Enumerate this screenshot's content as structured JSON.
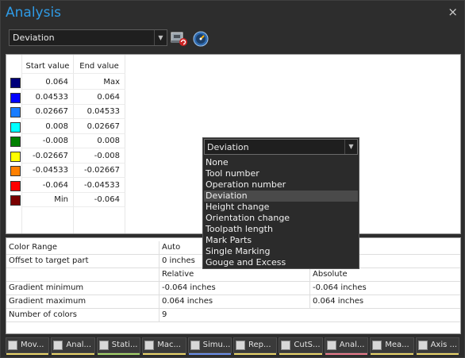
{
  "window": {
    "title": "Analysis",
    "close_glyph": "×"
  },
  "toolbar": {
    "mode_value": "Deviation",
    "icons": [
      "machine-icon",
      "gauge-icon"
    ]
  },
  "legend": {
    "headers": [
      "Start value",
      "End value"
    ],
    "rows": [
      {
        "color": "#00007a",
        "start": "0.064",
        "end": "Max"
      },
      {
        "color": "#0000ff",
        "start": "0.04533",
        "end": "0.064"
      },
      {
        "color": "#1a7dff",
        "start": "0.02667",
        "end": "0.04533"
      },
      {
        "color": "#00ffff",
        "start": "0.008",
        "end": "0.02667"
      },
      {
        "color": "#008000",
        "start": "-0.008",
        "end": "0.008"
      },
      {
        "color": "#ffff00",
        "start": "-0.02667",
        "end": "-0.008"
      },
      {
        "color": "#ff8000",
        "start": "-0.04533",
        "end": "-0.02667"
      },
      {
        "color": "#ff0000",
        "start": "-0.064",
        "end": "-0.04533"
      },
      {
        "color": "#7a0000",
        "start": "Min",
        "end": "-0.064"
      }
    ]
  },
  "properties": {
    "color_range_label": "Color Range",
    "color_range_value": "Auto",
    "offset_label": "Offset to target part",
    "offset_value": "0 inches",
    "relative_header": "Relative",
    "absolute_header": "Absolute",
    "grad_min_label": "Gradient minimum",
    "grad_min_rel": "-0.064 inches",
    "grad_min_abs": "-0.064 inches",
    "grad_max_label": "Gradient maximum",
    "grad_max_rel": "0.064 inches",
    "grad_max_abs": "0.064 inches",
    "num_colors_label": "Number of colors",
    "num_colors_value": "9"
  },
  "dropdown": {
    "value": "Deviation",
    "options": [
      "None",
      "Tool number",
      "Operation number",
      "Deviation",
      "Height change",
      "Orientation change",
      "Toolpath length",
      "Mark Parts",
      "Single Marking",
      "Gouge and Excess"
    ],
    "selected_index": 3
  },
  "tabs": [
    {
      "label": "Mov...",
      "underline": "#e8d36a"
    },
    {
      "label": "Anal...",
      "underline": "#e8d36a"
    },
    {
      "label": "Stati...",
      "underline": "#a6d36a"
    },
    {
      "label": "Mac...",
      "underline": "#e8d36a"
    },
    {
      "label": "Simu...",
      "underline": "#6a8ee8"
    },
    {
      "label": "Rep...",
      "underline": "#e8d36a"
    },
    {
      "label": "CutS...",
      "underline": "#e8d36a"
    },
    {
      "label": "Anal...",
      "underline": "#e87a8a"
    },
    {
      "label": "Mea...",
      "underline": "#e8d36a"
    },
    {
      "label": "Axis ...",
      "underline": "#e8d36a"
    }
  ]
}
